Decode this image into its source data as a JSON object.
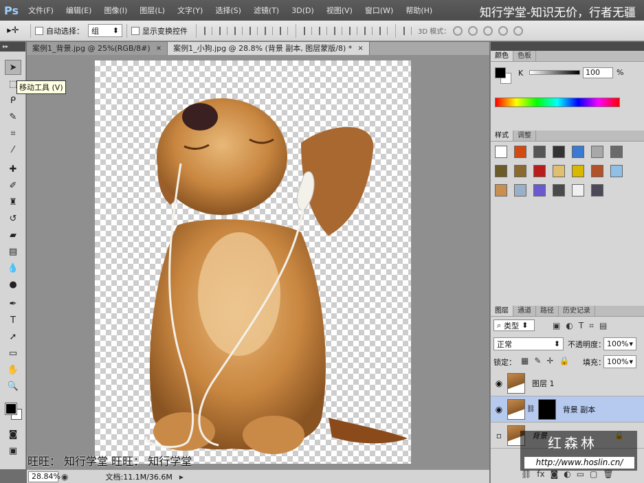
{
  "menubar": {
    "logo": "Ps",
    "items": [
      "文件(F)",
      "编辑(E)",
      "图像(I)",
      "图层(L)",
      "文字(Y)",
      "选择(S)",
      "滤镜(T)",
      "3D(D)",
      "视图(V)",
      "窗口(W)",
      "帮助(H)"
    ],
    "slogan": "知行学堂-知识无价，行者无疆"
  },
  "options": {
    "auto_select_label": "自动选择：",
    "auto_select_value": "组",
    "show_transform_label": "显示变换控件",
    "mode_3d_label": "3D 模式："
  },
  "tools": {
    "tooltip": "移动工具 (V)",
    "foreground": "#000000",
    "background": "#ffffff"
  },
  "tabs": [
    {
      "label": "案例1_背景.jpg @ 25%(RGB/8#)",
      "close": "×",
      "active": false
    },
    {
      "label": "案例1_小狗.jpg @ 28.8% (背景 副本, 图层蒙版/8) *",
      "close": "×",
      "active": true
    }
  ],
  "status": {
    "zoom": "28.84%",
    "doc_info": "文档:11.1M/36.6M"
  },
  "overlay": {
    "bottom_left_text": "旺旺： 知行学堂 旺旺： 知行学堂",
    "brand_title": "红森林",
    "brand_url": "http://www.hoslin.cn/"
  },
  "color_panel": {
    "tabs": [
      "颜色",
      "色板"
    ],
    "channel": "K",
    "value": "100",
    "unit": "%"
  },
  "styles_panel": {
    "tabs": [
      "样式",
      "调整"
    ],
    "swatches": [
      "#ffffff",
      "#d24a10",
      "#555555",
      "#333333",
      "#3a7ad0",
      "#a8a8a8",
      "#6a6a6a",
      "#6b5a2a",
      "#8b6a30",
      "#b81c1c",
      "#e0c070",
      "#d8b800",
      "#b0522a",
      "#90c0e8",
      "#c89050",
      "#9ab0c8",
      "#6a5ad0",
      "#4a4a4a",
      "#f0f0f0",
      "#4a4a58"
    ]
  },
  "layers_panel": {
    "tabs": [
      "图层",
      "通道",
      "路径",
      "历史记录"
    ],
    "filter_label": "类型",
    "blend_mode": "正常",
    "opacity_label": "不透明度：",
    "opacity_value": "100%",
    "lock_label": "锁定：",
    "fill_label": "填充：",
    "fill_value": "100%",
    "layers": [
      {
        "name": "图层 1",
        "visible": true,
        "selected": false
      },
      {
        "name": "背景 副本",
        "visible": true,
        "selected": true
      },
      {
        "name": "背景",
        "visible": false,
        "selected": false
      }
    ]
  }
}
